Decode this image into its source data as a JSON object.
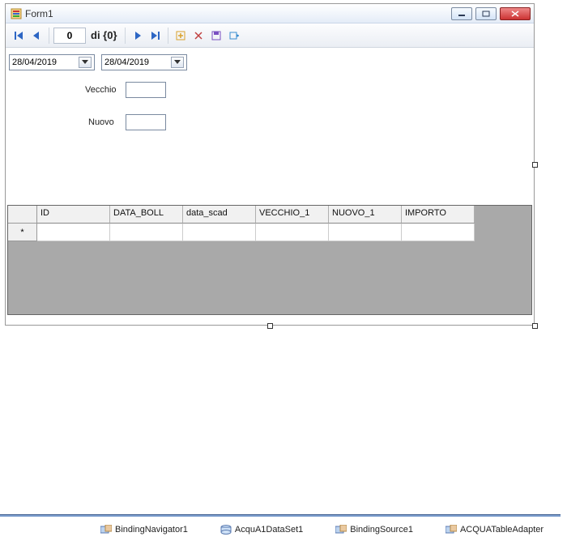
{
  "window": {
    "title": "Form1"
  },
  "nav": {
    "position": "0",
    "total_fmt": "di {0}"
  },
  "datepickers": {
    "d1": "28/04/2019",
    "d2": "28/04/2019"
  },
  "fields": {
    "vecchio_label": "Vecchio",
    "vecchio_value": "",
    "nuovo_label": "Nuovo",
    "nuovo_value": ""
  },
  "grid": {
    "columns": [
      "ID",
      "DATA_BOLL",
      "data_scad",
      "VECCHIO_1",
      "NUOVO_1",
      "IMPORTO"
    ],
    "new_row_marker": "*"
  },
  "tray": {
    "items": [
      "BindingNavigator1",
      "AcquA1DataSet1",
      "BindingSource1",
      "ACQUATableAdapter"
    ]
  }
}
